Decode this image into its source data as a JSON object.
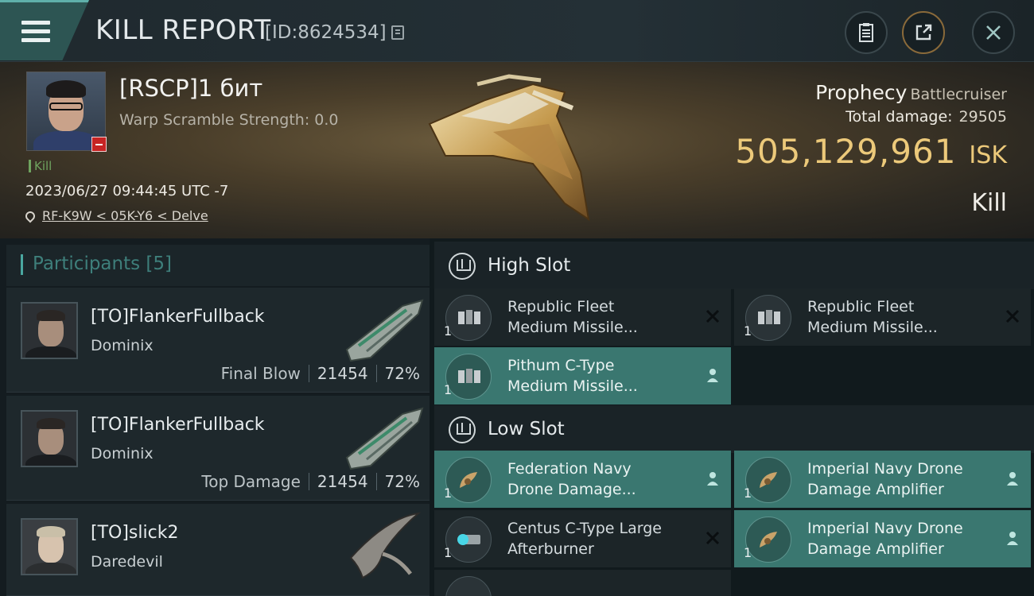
{
  "header": {
    "title": "KILL REPORT",
    "kill_id": "[ID:8624534]",
    "buttons": [
      "clipboard-icon",
      "share-icon",
      "close-icon"
    ]
  },
  "victim": {
    "name": "[RSCP]1 бит",
    "warp_scramble": "Warp Scramble Strength: 0.0",
    "tag": "Kill",
    "timestamp": "2023/06/27 09:44:45 UTC -7",
    "location": "RF-K9W < 05K-Y6 < Delve",
    "ship_name": "Prophecy",
    "ship_class": "Battlecruiser",
    "total_damage_label": "Total damage:",
    "total_damage": "29505",
    "isk_value": "505,129,961",
    "isk_unit": "ISK",
    "result": "Kill"
  },
  "participants": {
    "header": "Participants [5]",
    "rows": [
      {
        "name": "[TO]FlankerFullback",
        "ship": "Dominix",
        "role": "Final Blow",
        "damage": "21454",
        "percent": "72%"
      },
      {
        "name": "[TO]FlankerFullback",
        "ship": "Dominix",
        "role": "Top Damage",
        "damage": "21454",
        "percent": "72%"
      },
      {
        "name": "[TO]slick2",
        "ship": "Daredevil",
        "role": "",
        "damage": "",
        "percent": ""
      }
    ]
  },
  "fitting": {
    "high_slot": {
      "label": "High Slot",
      "modules": [
        {
          "name1": "Republic Fleet",
          "name2": "Medium Missile...",
          "qty": "1",
          "state": "destroyed",
          "icon": "missile-launcher-icon"
        },
        {
          "name1": "Republic Fleet",
          "name2": "Medium Missile...",
          "qty": "1",
          "state": "destroyed",
          "icon": "missile-launcher-icon"
        },
        {
          "name1": "Pithum C-Type",
          "name2": "Medium Missile...",
          "qty": "1",
          "state": "dropped",
          "icon": "missile-launcher-icon"
        }
      ]
    },
    "low_slot": {
      "label": "Low Slot",
      "modules": [
        {
          "name1": "Federation Navy",
          "name2": "Drone Damage...",
          "qty": "1",
          "state": "dropped",
          "icon": "drone-amplifier-icon"
        },
        {
          "name1": "Imperial Navy Drone",
          "name2": "Damage Amplifier",
          "qty": "1",
          "state": "dropped",
          "icon": "drone-amplifier-icon"
        },
        {
          "name1": "Centus C-Type Large",
          "name2": "Afterburner",
          "qty": "1",
          "state": "destroyed",
          "icon": "afterburner-icon"
        },
        {
          "name1": "Imperial Navy Drone",
          "name2": "Damage Amplifier",
          "qty": "1",
          "state": "dropped",
          "icon": "drone-amplifier-icon"
        }
      ]
    }
  },
  "colors": {
    "accent_teal": "#3a7770",
    "isk_gold": "#ecc97a",
    "kill_green": "#6fa35f",
    "badge_red": "#c62424"
  }
}
